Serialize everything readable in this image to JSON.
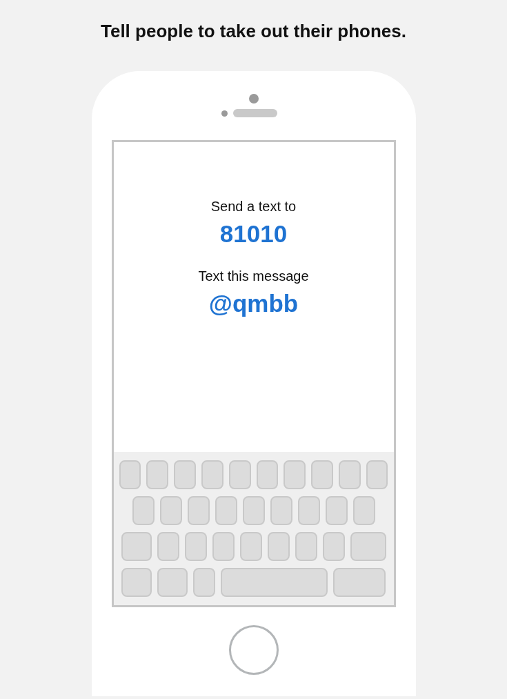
{
  "heading": "Tell people to take out their phones.",
  "phone_screen": {
    "lines": [
      {
        "kind": "label",
        "text": "Send a text to"
      },
      {
        "kind": "value",
        "text": "81010"
      },
      {
        "kind": "label",
        "text": "Text this message"
      },
      {
        "kind": "value",
        "text": "@qmbb"
      }
    ]
  }
}
